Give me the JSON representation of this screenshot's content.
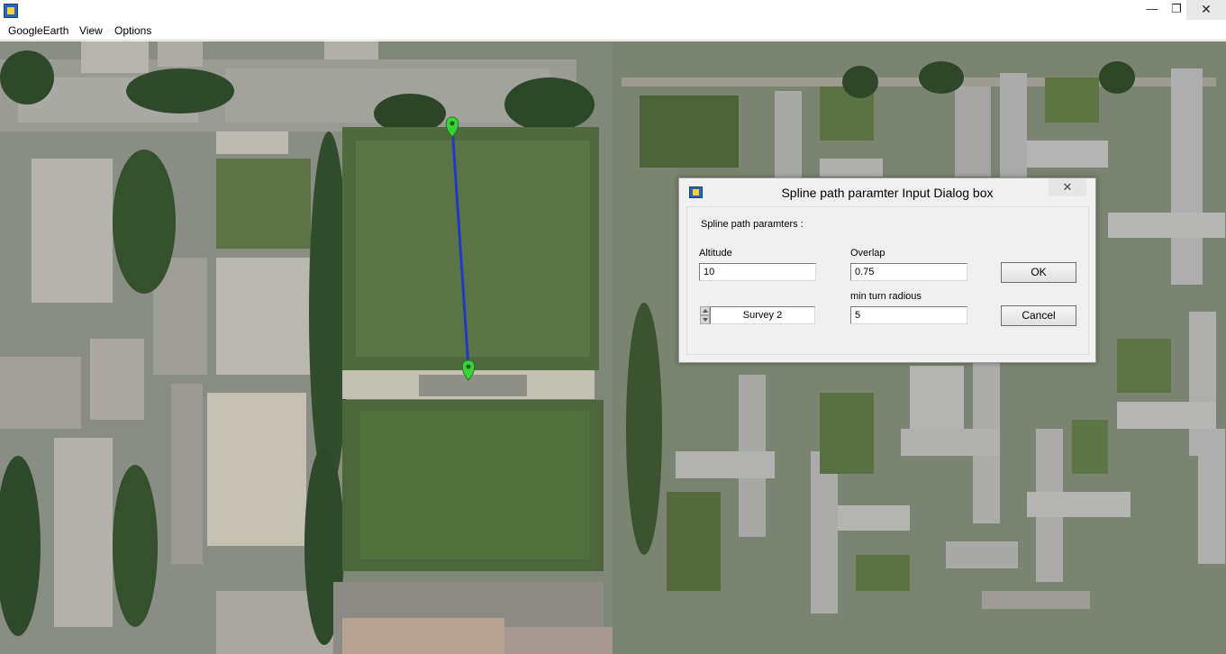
{
  "window": {
    "minimize_glyph": "—",
    "maximize_glyph": "❐",
    "close_glyph": "✕"
  },
  "menu": {
    "items": [
      "GoogleEarth",
      "View",
      "Options"
    ]
  },
  "map": {
    "marker_color": "#3bd13b",
    "path_color": "#2638c8"
  },
  "dialog": {
    "title": "Spline path  paramter Input Dialog box",
    "close_glyph": "✕",
    "section_label": "Spline path  paramters :",
    "altitude_label": "Altitude",
    "altitude_value": "10",
    "overlap_label": "Overlap",
    "overlap_value": "0.75",
    "min_turn_label": "min turn radious",
    "min_turn_value": "5",
    "survey_value": "Survey 2",
    "ok_label": "OK",
    "cancel_label": "Cancel"
  }
}
